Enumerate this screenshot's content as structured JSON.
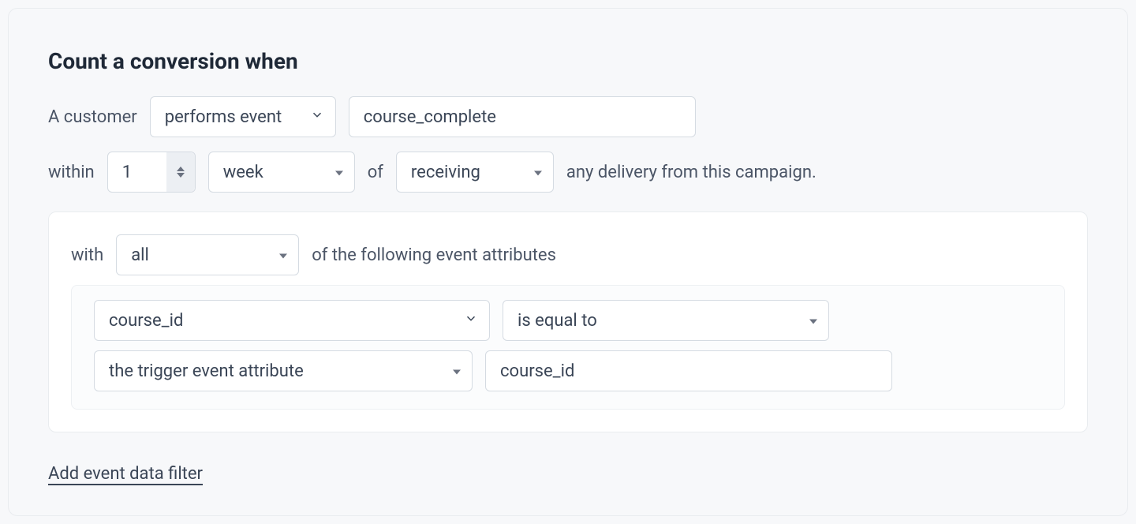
{
  "heading": "Count a conversion when",
  "row1": {
    "prefix": "A customer",
    "action_select": "performs event",
    "event_name": "course_complete"
  },
  "row2": {
    "prefix": "within",
    "count": "1",
    "unit": "week",
    "of": "of",
    "timing": "receiving",
    "suffix": "any delivery from this campaign."
  },
  "nested": {
    "with": "with",
    "match": "all",
    "suffix": "of the following event attributes"
  },
  "filter": {
    "attribute": "course_id",
    "operator": "is equal to",
    "value_type": "the trigger event attribute",
    "value": "course_id"
  },
  "link": "Add event data filter"
}
